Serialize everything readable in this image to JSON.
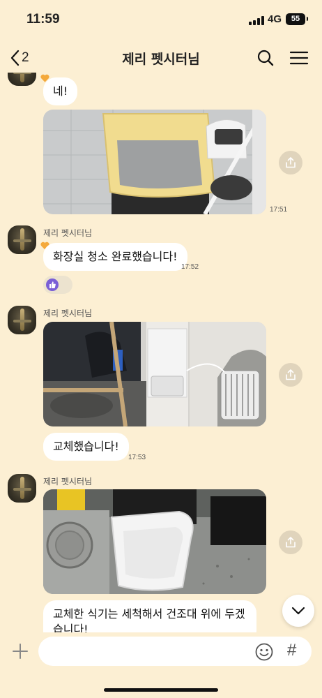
{
  "status_bar": {
    "time": "11:59",
    "network": "4G",
    "battery": "55"
  },
  "header": {
    "back_count": "2",
    "title": "제리 펫시터님"
  },
  "messages": [
    {
      "text": "네!"
    },
    {
      "time": "17:51"
    },
    {
      "sender": "제리 펫시터님",
      "text": "화장실 청소 완료했습니다!",
      "time": "17:52"
    },
    {
      "sender": "제리 펫시터님"
    },
    {
      "text": "교체했습니다!",
      "time": "17:53"
    },
    {
      "sender": "제리 펫시터님"
    },
    {
      "text": "교체한 식기는 세척해서 건조대 위에 두겠습니다!"
    }
  ],
  "input": {
    "value": "",
    "placeholder": ""
  },
  "icons": {
    "back": "chevron-left-icon",
    "search": "search-icon",
    "menu": "hamburger-menu-icon",
    "share": "share-icon",
    "reaction": "thumbs-up-icon",
    "heart": "heart-icon",
    "scroll": "chevron-down-icon",
    "plus": "plus-icon",
    "emoji": "smiley-icon",
    "hash": "hash-icon"
  },
  "colors": {
    "background": "#FCEFD3",
    "bubble": "#FFFFFF",
    "heart": "#F4A93B",
    "reaction": "#7A5FD6"
  }
}
